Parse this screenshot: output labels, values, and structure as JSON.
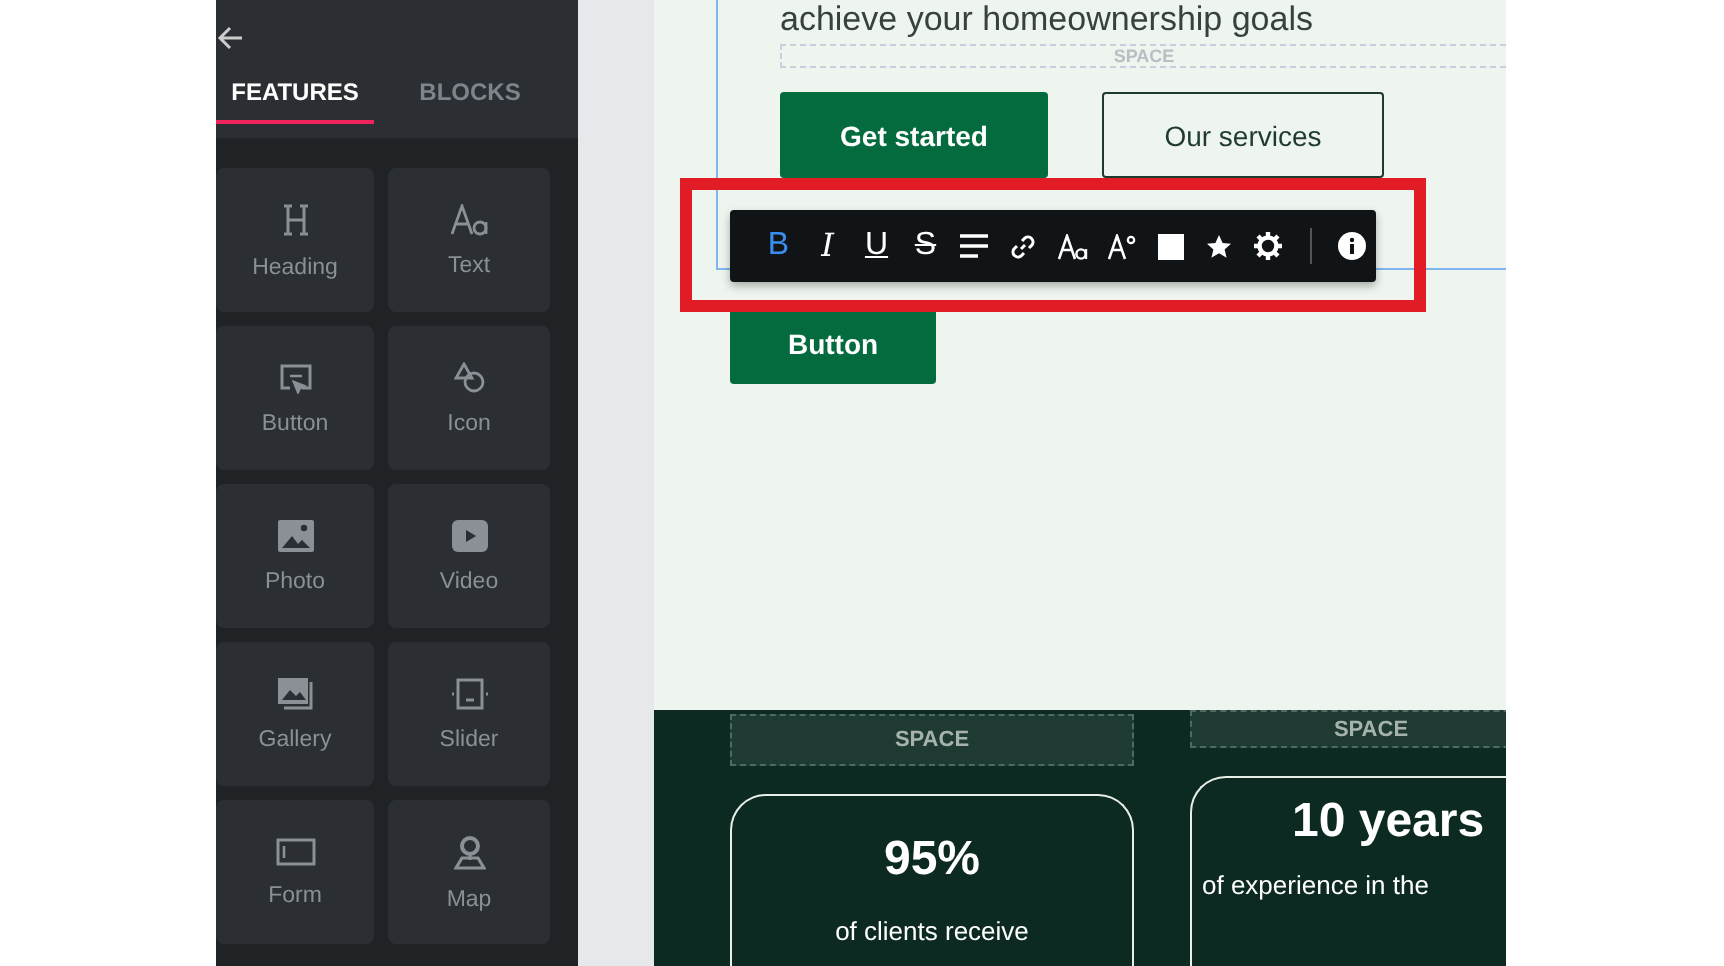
{
  "sidebar": {
    "tabs": [
      {
        "label": "FEATURES",
        "selected": true
      },
      {
        "label": "BLOCKS",
        "selected": false
      }
    ],
    "items": [
      {
        "label": "Heading",
        "kind": "heading"
      },
      {
        "label": "Text",
        "kind": "text"
      },
      {
        "label": "Button",
        "kind": "button"
      },
      {
        "label": "Icon",
        "kind": "icon"
      },
      {
        "label": "Photo",
        "kind": "photo"
      },
      {
        "label": "Video",
        "kind": "video"
      },
      {
        "label": "Gallery",
        "kind": "gallery"
      },
      {
        "label": "Slider",
        "kind": "slider"
      },
      {
        "label": "Form",
        "kind": "form"
      },
      {
        "label": "Map",
        "kind": "map"
      }
    ]
  },
  "canvas": {
    "heading": "achieve your homeownership goals",
    "space_label": "SPACE",
    "buttons": [
      {
        "label": "Get started",
        "kind": "filled"
      },
      {
        "label": "Our services",
        "kind": "outline"
      }
    ],
    "toolbar": [
      {
        "kind": "glyph",
        "label": "B",
        "selected": true
      },
      {
        "kind": "italic",
        "label": "I",
        "selected": false
      },
      {
        "kind": "underline",
        "label": "U",
        "selected": false
      },
      {
        "kind": "strike",
        "label": "S",
        "selected": false
      },
      {
        "kind": "align",
        "selected": false
      },
      {
        "kind": "link",
        "selected": false
      },
      {
        "kind": "font",
        "selected": false
      },
      {
        "kind": "size",
        "selected": false
      },
      {
        "kind": "color",
        "color": "#ffffff",
        "selected": false
      },
      {
        "kind": "star",
        "selected": false
      },
      {
        "kind": "gear",
        "selected": false
      },
      {
        "kind": "divider"
      },
      {
        "kind": "info",
        "selected": false
      }
    ],
    "selected_button": "Button",
    "stats": [
      {
        "space_label": "SPACE",
        "value": "95%",
        "caption": "of clients receive"
      },
      {
        "space_label": "SPACE",
        "value": "10 years",
        "caption": "of experience in the"
      }
    ]
  }
}
